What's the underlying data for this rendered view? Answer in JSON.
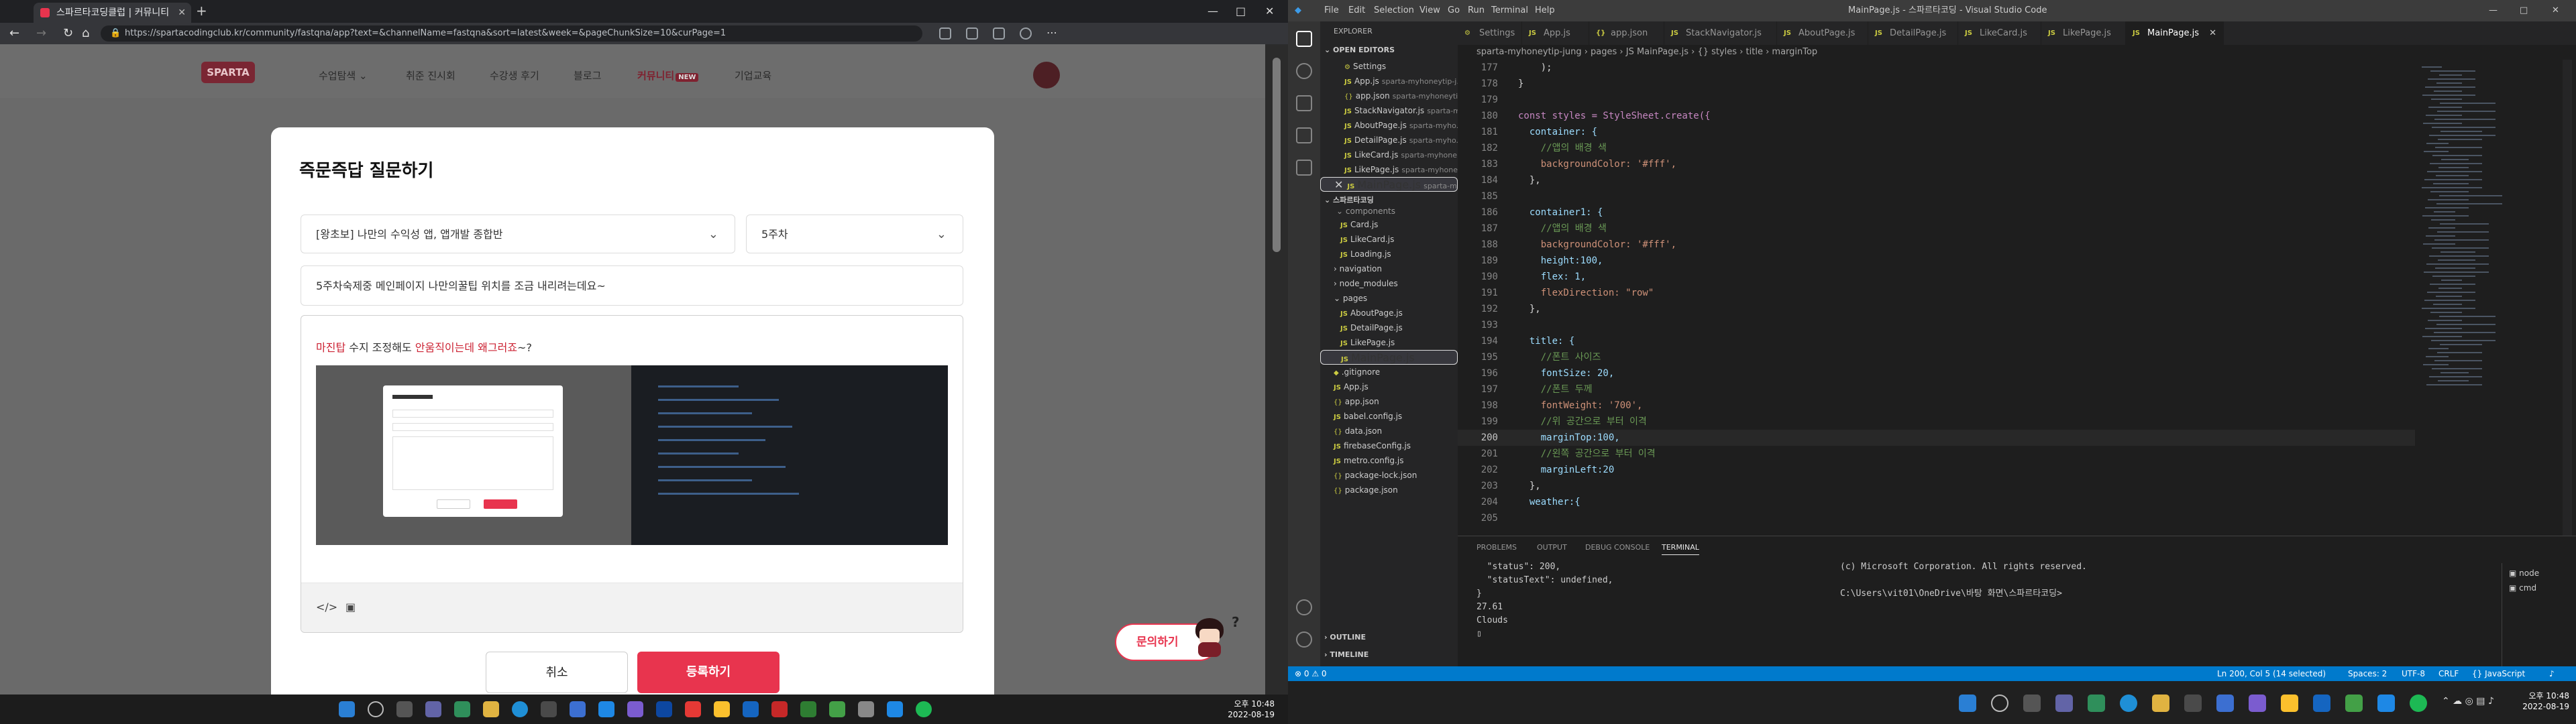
{
  "browser": {
    "tab_title": "스파르타코딩클럽 | 커뮤니티",
    "new_tab": "+",
    "url": "https://spartacodingclub.kr/community/fastqna/app?text=&channelName=fastqna&sort=latest&week=&pageChunkSize=10&curPage=1",
    "win_min": "—",
    "win_max": "□",
    "win_close": "✕"
  },
  "site": {
    "logo": "SPARTA",
    "nav": [
      "수업탐색 ⌄",
      "취준 진시회",
      "수강생 후기",
      "블로그",
      "커뮤니티",
      "기업교육"
    ],
    "nav_badge": "NEW"
  },
  "modal": {
    "title": "즉문즉답 질문하기",
    "course_select": "[왕초보] 나만의 수익성 앱, 앱개발 종합반",
    "week_select": "5주차",
    "question_title": "5주차숙제중 메인페이지 나만의꿀팁 위치를 조금 내리려는데요~",
    "body_prefix": " 수지 조정해도 ",
    "body_link1": "마진탑",
    "body_link2": "안움직이는데 왜그러죠",
    "body_suffix": "~?",
    "toolbar_code": "</>",
    "toolbar_image": "▣",
    "cancel": "취소",
    "submit": "등록하기"
  },
  "inquiry": "문의하기",
  "taskbar_left": {
    "time": "오후 10:48",
    "date": "2022-08-19"
  },
  "vscode": {
    "menu": [
      "File",
      "Edit",
      "Selection",
      "View",
      "Go",
      "Run",
      "Terminal",
      "Help"
    ],
    "window_title": "MainPage.js - 스파르타코딩 - Visual Studio Code",
    "explorer_title": "EXPLORER",
    "open_editors": "OPEN EDITORS",
    "open_files": [
      {
        "name": "Settings",
        "dim": ""
      },
      {
        "name": "App.js",
        "dim": "sparta-myhoneytip-j..."
      },
      {
        "name": "app.json",
        "dim": "sparta-myhoneyti..."
      },
      {
        "name": "StackNavigator.js",
        "dim": "sparta-m..."
      },
      {
        "name": "AboutPage.js",
        "dim": "sparta-myho..."
      },
      {
        "name": "DetailPage.js",
        "dim": "sparta-myho..."
      },
      {
        "name": "LikeCard.js",
        "dim": "sparta-myhone..."
      },
      {
        "name": "LikePage.js",
        "dim": "sparta-myhone..."
      },
      {
        "name": "MainPage.js",
        "dim": "sparta-myhon..."
      }
    ],
    "workspace": "스파르타코딩",
    "tree": [
      "components",
      "Card.js",
      "LikeCard.js",
      "Loading.js",
      "navigation",
      "node_modules",
      "pages",
      "AboutPage.js",
      "DetailPage.js",
      "LikePage.js",
      "MainPage.js",
      ".gitignore",
      "App.js",
      "app.json",
      "babel.config.js",
      "data.json",
      "firebaseConfig.js",
      "metro.config.js",
      "package-lock.json",
      "package.json"
    ],
    "outline": "OUTLINE",
    "timeline": "TIMELINE",
    "tabs": [
      "Settings",
      "App.js",
      "app.json",
      "StackNavigator.js",
      "AboutPage.js",
      "DetailPage.js",
      "LikeCard.js",
      "LikePage.js",
      "MainPage.js"
    ],
    "breadcrumb": "sparta-myhoneytip-jung  ›  pages  ›  JS MainPage.js  ›  {} styles  ›  title  ›  marginTop",
    "code_lines": [
      {
        "n": "177",
        "t": "    );"
      },
      {
        "n": "178",
        "t": "}"
      },
      {
        "n": "179",
        "t": ""
      },
      {
        "n": "180",
        "t": "const styles = StyleSheet.create({"
      },
      {
        "n": "181",
        "t": "  container: {"
      },
      {
        "n": "182",
        "t": "    //앱의 배경 색"
      },
      {
        "n": "183",
        "t": "    backgroundColor: '#fff',"
      },
      {
        "n": "184",
        "t": "  },"
      },
      {
        "n": "185",
        "t": ""
      },
      {
        "n": "186",
        "t": "  container1: {"
      },
      {
        "n": "187",
        "t": "    //앱의 배경 색"
      },
      {
        "n": "188",
        "t": "    backgroundColor: '#fff',"
      },
      {
        "n": "189",
        "t": "    height:100,"
      },
      {
        "n": "190",
        "t": "    flex: 1,"
      },
      {
        "n": "191",
        "t": "    flexDirection: \"row\""
      },
      {
        "n": "192",
        "t": "  },"
      },
      {
        "n": "193",
        "t": ""
      },
      {
        "n": "194",
        "t": "  title: {"
      },
      {
        "n": "195",
        "t": "    //폰트 사이즈"
      },
      {
        "n": "196",
        "t": "    fontSize: 20,"
      },
      {
        "n": "197",
        "t": "    //폰트 두께"
      },
      {
        "n": "198",
        "t": "    fontWeight: '700',"
      },
      {
        "n": "199",
        "t": "    //위 공간으로 부터 이격"
      },
      {
        "n": "200",
        "t": "    marginTop:100,"
      },
      {
        "n": "201",
        "t": "    //왼쪽 공간으로 부터 이격"
      },
      {
        "n": "202",
        "t": "    marginLeft:20"
      },
      {
        "n": "203",
        "t": "  },"
      },
      {
        "n": "204",
        "t": "  weather:{"
      },
      {
        "n": "205",
        "t": ""
      }
    ],
    "panel_tabs": [
      "PROBLEMS",
      "OUTPUT",
      "DEBUG CONSOLE",
      "TERMINAL"
    ],
    "term_left": "  \"status\": 200,\n  \"statusText\": undefined,\n}\n27.61\nClouds\n▯",
    "term_right": "(c) Microsoft Corporation. All rights reserved.\n\nC:\\Users\\vit01\\OneDrive\\바탕 화면\\스파르타코딩>",
    "term_list": [
      "node",
      "cmd"
    ],
    "status_left": "⊗ 0  ⚠ 0",
    "status_right": [
      "Ln 200, Col 5 (14 selected)",
      "Spaces: 2",
      "UTF-8",
      "CRLF",
      "{} JavaScript"
    ],
    "time": "오후 10:48",
    "date": "2022-08-19"
  },
  "colors": {
    "accent": "#e8344e",
    "vscode_blue": "#007acc"
  }
}
